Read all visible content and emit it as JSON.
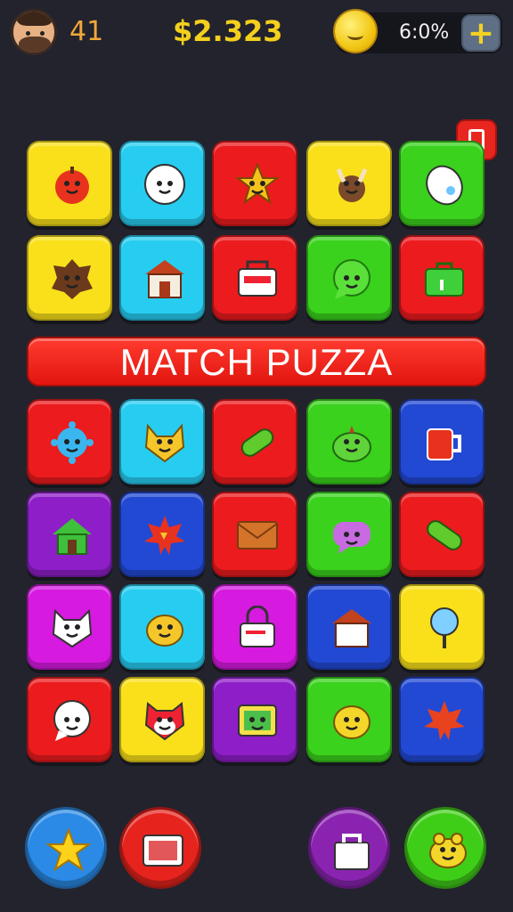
{
  "hud": {
    "level": "41",
    "money": "$2.323",
    "percent": "6:0%",
    "plus": "+"
  },
  "banner": "MATCH PUZZA",
  "grid": [
    [
      {
        "color": "yellow",
        "icon": "apple-icon"
      },
      {
        "color": "cyan",
        "icon": "smiley-face-icon"
      },
      {
        "color": "red",
        "icon": "star-creature-icon"
      },
      {
        "color": "yellow",
        "icon": "moose-icon"
      },
      {
        "color": "green",
        "icon": "jellybean-icon"
      }
    ],
    [
      {
        "color": "yellow",
        "icon": "hedgehog-icon"
      },
      {
        "color": "cyan",
        "icon": "barn-icon"
      },
      {
        "color": "red",
        "icon": "cash-register-icon"
      },
      {
        "color": "green",
        "icon": "chat-bubble-icon"
      },
      {
        "color": "red",
        "icon": "briefcase-icon"
      }
    ],
    [
      {
        "color": "red",
        "icon": "virus-icon"
      },
      {
        "color": "cyan",
        "icon": "cat-face-icon"
      },
      {
        "color": "red",
        "icon": "pickle-icon"
      },
      {
        "color": "green",
        "icon": "slime-icon"
      },
      {
        "color": "blue",
        "icon": "mug-icon"
      }
    ],
    [
      {
        "color": "purple",
        "icon": "house-icon"
      },
      {
        "color": "blue",
        "icon": "maple-leaf-icon"
      },
      {
        "color": "red",
        "icon": "envelope-icon"
      },
      {
        "color": "green",
        "icon": "speech-bubble-icon"
      },
      {
        "color": "red",
        "icon": "pill-icon"
      }
    ],
    [
      {
        "color": "magenta",
        "icon": "kitten-icon"
      },
      {
        "color": "cyan",
        "icon": "blob-face-icon"
      },
      {
        "color": "magenta",
        "icon": "padlock-icon"
      },
      {
        "color": "blue",
        "icon": "shed-icon"
      },
      {
        "color": "yellow",
        "icon": "balloon-icon"
      }
    ],
    [
      {
        "color": "red",
        "icon": "message-bubble-icon"
      },
      {
        "color": "yellow",
        "icon": "red-panda-icon"
      },
      {
        "color": "purple",
        "icon": "tv-screen-icon"
      },
      {
        "color": "green",
        "icon": "lemon-face-icon"
      },
      {
        "color": "blue",
        "icon": "autumn-leaf-icon"
      }
    ]
  ],
  "bottom_buttons": [
    {
      "color": "#2a8ae6",
      "icon": "star-icon"
    },
    {
      "color": "#e6231d",
      "icon": "tablet-icon"
    },
    {
      "color": "#8a24b0",
      "icon": "shopping-bag-icon"
    },
    {
      "color": "#3fce18",
      "icon": "frog-icon"
    }
  ]
}
